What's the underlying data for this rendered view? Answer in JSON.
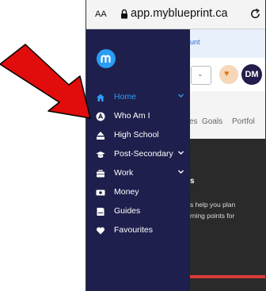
{
  "browser": {
    "text_size_label": "AA",
    "url": "app.myblueprint.ca",
    "lock_icon": "lock-icon",
    "reload_icon": "reload-icon"
  },
  "background_page": {
    "banner_text": "unt",
    "profile_initials": "DM",
    "tabs": [
      "es",
      "Goals",
      "Portfol"
    ],
    "card_heading": "s",
    "card_line_1": "s help you plan",
    "card_line_2": "rning points for"
  },
  "drawer": {
    "logo_icon": "blueprint-logo-icon",
    "items": [
      {
        "label": "Home",
        "icon": "home-icon",
        "has_chevron": true,
        "active": true
      },
      {
        "label": "Who Am I",
        "icon": "who-am-i-icon",
        "has_chevron": false,
        "active": false
      },
      {
        "label": "High School",
        "icon": "high-school-icon",
        "has_chevron": false,
        "active": false
      },
      {
        "label": "Post-Secondary",
        "icon": "graduation-cap-icon",
        "has_chevron": true,
        "active": false
      },
      {
        "label": "Work",
        "icon": "briefcase-icon",
        "has_chevron": true,
        "active": false
      },
      {
        "label": "Money",
        "icon": "money-icon",
        "has_chevron": false,
        "active": false
      },
      {
        "label": "Guides",
        "icon": "guides-icon",
        "has_chevron": false,
        "active": false
      },
      {
        "label": "Favourites",
        "icon": "heart-icon",
        "has_chevron": false,
        "active": false
      }
    ]
  },
  "colors": {
    "drawer_bg": "#1f1f4d",
    "accent": "#2a9df4",
    "annotation_arrow": "#e10c0c"
  },
  "annotation": {
    "arrow_icon": "red-arrow-annotation",
    "points_to": "Who Am I"
  }
}
